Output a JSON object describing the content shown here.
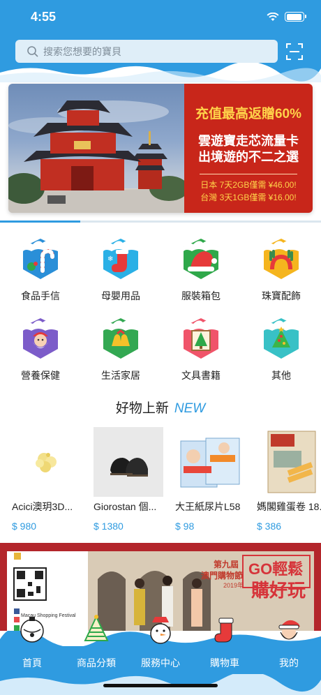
{
  "status": {
    "time": "4:55"
  },
  "search": {
    "placeholder": "搜索您想要的寶貝"
  },
  "banner": {
    "headline": "充值最高返贈60%",
    "title_line1": "雲遊寶走芯流量卡",
    "title_line2": "出境遊的不二之選",
    "offer_line1": "日本 7天2GB僅需 ¥46.00!",
    "offer_line2": "台灣 3天1GB僅需 ¥16.00!"
  },
  "categories": [
    {
      "label": "食品手信",
      "icon": "candy-cane-icon",
      "color": "#2a8fd8"
    },
    {
      "label": "母嬰用品",
      "icon": "stocking-icon",
      "color": "#2ab0e6"
    },
    {
      "label": "服裝箱包",
      "icon": "santa-hat-icon",
      "color": "#2fa84a"
    },
    {
      "label": "珠寶配飾",
      "icon": "antlers-icon",
      "color": "#f5b51e"
    },
    {
      "label": "營養保健",
      "icon": "santa-face-icon",
      "color": "#7c5cc9"
    },
    {
      "label": "生活家居",
      "icon": "bells-icon",
      "color": "#33a852"
    },
    {
      "label": "文具書籍",
      "icon": "christmas-tree-icon",
      "color": "#f0546a"
    },
    {
      "label": "其他",
      "icon": "ornament-tree-icon",
      "color": "#38c1c6"
    }
  ],
  "new_section": {
    "title": "好物上新",
    "title_en": "NEW"
  },
  "products": [
    {
      "name": "Acici澳玥3D...",
      "price": "$ 980"
    },
    {
      "name": "Giorostan 個...",
      "price": "$ 1380"
    },
    {
      "name": "大王紙尿片L58",
      "price": "$ 98"
    },
    {
      "name": "媽閣雞蛋卷 18...",
      "price": "$ 386"
    }
  ],
  "promo": {
    "qr_caption": "Macau Shopping Festival",
    "festival_line1": "第九屆",
    "festival_line2": "澳門購物節",
    "festival_year": "2019年",
    "slogan_go": "GO輕鬆",
    "slogan_main": "購好玩"
  },
  "tabbar": [
    {
      "label": "首頁"
    },
    {
      "label": "商品分類"
    },
    {
      "label": "服務中心"
    },
    {
      "label": "購物車"
    },
    {
      "label": "我的"
    }
  ],
  "colors": {
    "primary": "#2f9be0",
    "banner_red": "#c8261a",
    "price": "#2f9be0"
  }
}
